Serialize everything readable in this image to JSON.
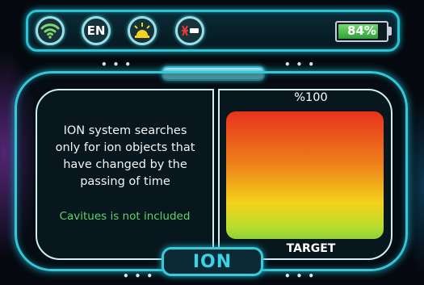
{
  "header": {
    "icons": [
      "wifi-icon",
      "language-icon",
      "lamp-icon",
      "laser-icon"
    ],
    "language_label": "EN",
    "battery": {
      "percent": 84,
      "label": "84%"
    }
  },
  "left_panel": {
    "message_lines": [
      "ION system searches",
      "only for ion objects that",
      "have changed by the",
      "passing of time"
    ],
    "note": "Cavitues is not included"
  },
  "right_panel": {
    "max_label": "%100",
    "target_label": "TARGET"
  },
  "mode": {
    "label": "ION"
  },
  "colors": {
    "accent": "#35c6d8",
    "note": "#5dd46a",
    "gauge_top": "#e8321f",
    "gauge_bottom": "#8fd13d"
  }
}
